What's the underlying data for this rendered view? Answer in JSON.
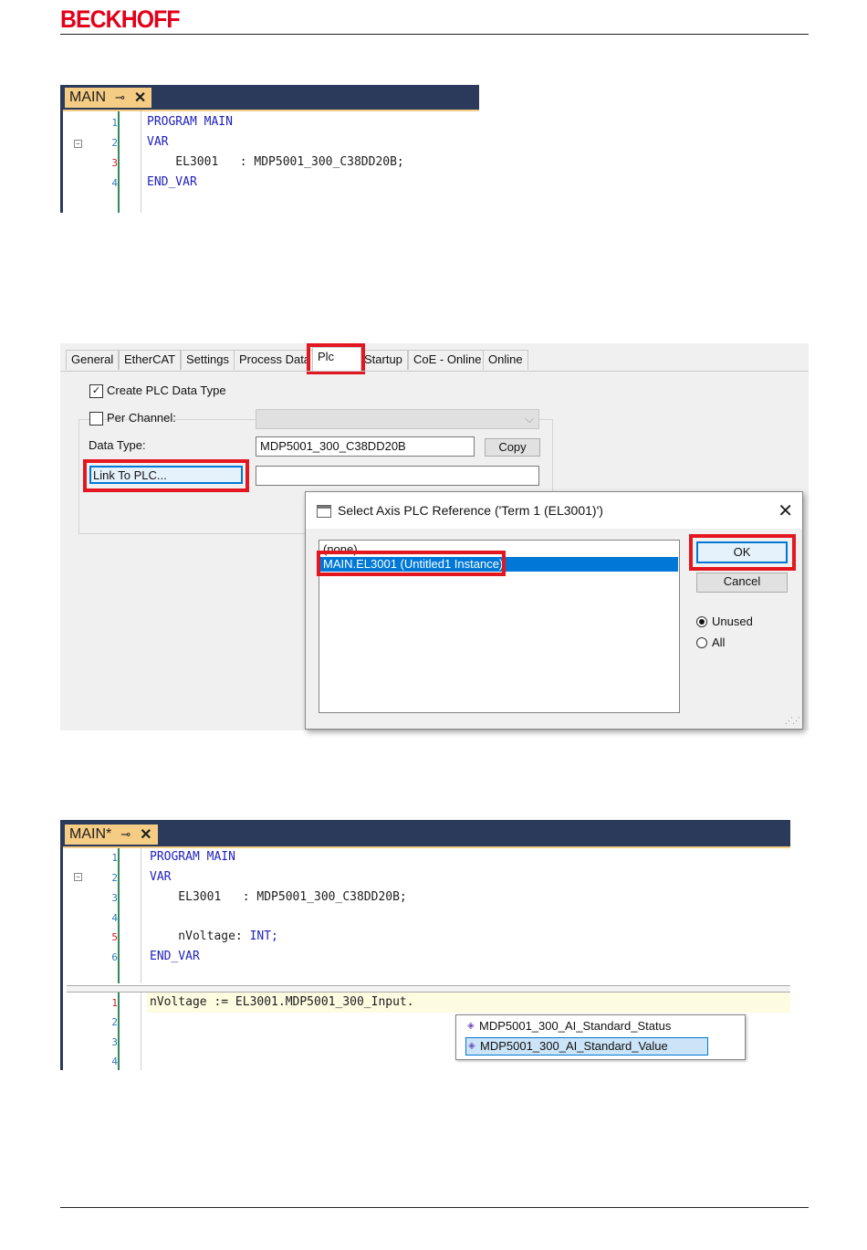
{
  "header": {
    "logo_text": "BECKHOFF"
  },
  "editor1": {
    "tab_title": "MAIN",
    "line_numbers": [
      "1",
      "2",
      "3",
      "4"
    ],
    "lines": [
      {
        "kw": "PROGRAM MAIN",
        "text": ""
      },
      {
        "kw": "VAR",
        "text": ""
      },
      {
        "kw": "",
        "text": "    EL3001   : MDP5001_300_C38DD20B;"
      },
      {
        "kw": "END_VAR",
        "text": ""
      }
    ]
  },
  "props": {
    "tabs": [
      "General",
      "EtherCAT",
      "Settings",
      "Process Data",
      "Plc",
      "Startup",
      "CoE - Online",
      "Online"
    ],
    "create_plc_data_type_label": "Create PLC Data Type",
    "per_channel_label": "Per Channel:",
    "data_type_label": "Data Type:",
    "data_type_value": "MDP5001_300_C38DD20B",
    "copy_button": "Copy",
    "link_to_plc_button": "Link To PLC...",
    "link_value": ""
  },
  "dialog": {
    "title": "Select Axis PLC Reference ('Term 1 (EL3001)')",
    "list_items": [
      "(none)",
      "MAIN.EL3001 (Untitled1 Instance)"
    ],
    "ok_button": "OK",
    "cancel_button": "Cancel",
    "radio_unused": "Unused",
    "radio_all": "All"
  },
  "editor2": {
    "tab_title": "MAIN*",
    "decl_line_numbers": [
      "1",
      "2",
      "3",
      "4",
      "5",
      "6"
    ],
    "decl_lines": [
      {
        "kw": "PROGRAM MAIN",
        "text": ""
      },
      {
        "kw": "VAR",
        "text": ""
      },
      {
        "kw": "",
        "text": "    EL3001   : MDP5001_300_C38DD20B;"
      },
      {
        "kw": "",
        "text": ""
      },
      {
        "kw": "",
        "text": "    nVoltage: "
      },
      {
        "kw": "END_VAR",
        "text": ""
      }
    ],
    "int_keyword": "INT;",
    "impl_line_numbers": [
      "1",
      "2",
      "3",
      "4"
    ],
    "impl_line1": "nVoltage := EL3001.MDP5001_300_Input.",
    "autocomplete": [
      "MDP5001_300_AI_Standard_Status",
      "MDP5001_300_AI_Standard_Value"
    ]
  }
}
